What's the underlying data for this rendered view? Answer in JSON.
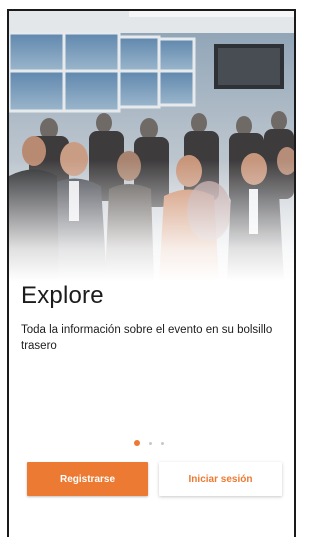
{
  "onboarding": {
    "title": "Explore",
    "description": "Toda la información sobre el evento en su bolsillo trasero",
    "pager": {
      "total_pages": 3,
      "current_page": 1
    },
    "register_button": "Registrarse",
    "login_button": "Iniciar sesión"
  },
  "colors": {
    "accent": "#ec7a32",
    "text": "#1c1c1c",
    "background": "#ffffff",
    "dot_inactive": "#c8c8c8"
  },
  "hero_image": {
    "subject": "crowd-at-networking-event-photo"
  }
}
